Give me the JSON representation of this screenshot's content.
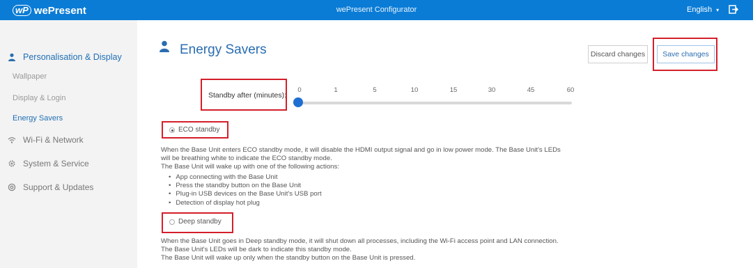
{
  "topbar": {
    "brand": "wePresent",
    "logo_mark": "wP",
    "title": "wePresent Configurator",
    "language": "English",
    "language_caret": "▾",
    "logout_icon": "logout-icon"
  },
  "sidebar": {
    "active_group": "Personalisation & Display",
    "sub_items": [
      "Wallpaper",
      "Display & Login",
      "Energy Savers"
    ],
    "groups": [
      "Wi-Fi & Network",
      "System & Service",
      "Support & Updates"
    ]
  },
  "main": {
    "title": "Energy Savers",
    "discard_label": "Discard changes",
    "save_label": "Save changes",
    "standby_label": "Standby after (minutes):",
    "standby_options": [
      "0",
      "1",
      "5",
      "10",
      "15",
      "30",
      "45",
      "60"
    ],
    "standby_selected": "0",
    "eco": {
      "label": "ECO standby",
      "selected": true,
      "desc1": "When the Base Unit enters ECO standby mode, it will disable the HDMI output signal and go in low power mode. The Base Unit's LEDs",
      "desc2": "will be breathing white to indicate the ECO standby mode.",
      "desc3": "The Base Unit will wake up with one of the following actions:",
      "actions": [
        "App connecting with the Base Unit",
        "Press the standby button on the Base Unit",
        "Plug-in USB devices on the Base Unit's USB port",
        "Detection of display hot plug"
      ]
    },
    "deep": {
      "label": "Deep standby",
      "selected": false,
      "desc1": "When the Base Unit goes in Deep standby mode, it will shut down all processes, including the Wi-Fi access point and LAN connection.",
      "desc2": "The Base Unit's LEDs will be dark to indicate this standby mode.",
      "desc3": "The Base Unit will wake up only when the standby button on the Base Unit is pressed."
    }
  },
  "colors": {
    "topbar": "#0a7cd6",
    "accent": "#2a6db0",
    "highlight_box": "#d31f2a",
    "slider_knob": "#1e6fd1"
  }
}
